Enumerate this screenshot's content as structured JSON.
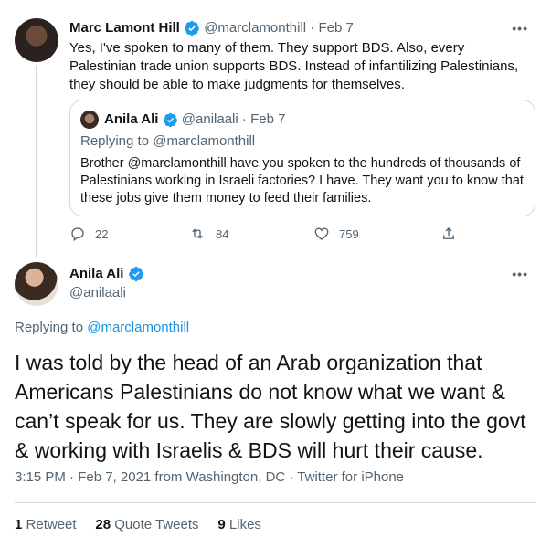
{
  "quoted_thread": {
    "author_name": "Marc Lamont Hill",
    "author_handle": "@marclamonthill",
    "date": "Feb 7",
    "text": "Yes, I've spoken to many of them. They support BDS. Also, every Palestinian trade union supports BDS. Instead of infantilizing Palestinians, they should be able to make judgments for themselves.",
    "quote": {
      "author_name": "Anila Ali",
      "author_handle": "@anilaali",
      "date": "Feb 7",
      "replying_to_label": "Replying to",
      "replying_to_handle": "@marclamonthill",
      "text": "Brother @marclamonthill have you spoken to the hundreds of thousands of Palestinians working in Israeli factories? I have. They want you to know that these jobs give them money to feed their families."
    },
    "actions": {
      "replies": "22",
      "retweets": "84",
      "likes": "759"
    }
  },
  "main_tweet": {
    "author_name": "Anila Ali",
    "author_handle": "@anilaali",
    "replying_to_label": "Replying to",
    "replying_to_handle": "@marclamonthill",
    "text": "I was told by the head of an Arab organization that Americans Palestinians do not know what we want & can’t speak for us. They are slowly getting into the govt & working with Israelis & BDS will hurt their cause.",
    "time": "3:15 PM · Feb 7, 2021 from Washington, DC · Twitter for iPhone",
    "stats": {
      "retweets_count": "1",
      "retweets_label": "Retweet",
      "quote_count": "28",
      "quote_label": "Quote Tweets",
      "likes_count": "9",
      "likes_label": "Likes"
    }
  },
  "more_glyph": "•••",
  "colors": {
    "link": "#1b95e0",
    "verified": "#1d9bf0",
    "muted": "#536471",
    "border": "#cfd9de"
  }
}
